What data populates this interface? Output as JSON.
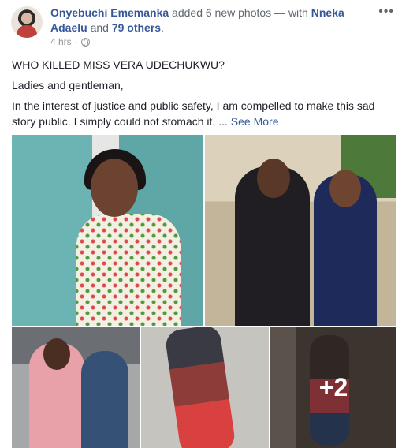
{
  "post": {
    "author": "Onyebuchi Ememanka",
    "action": " added 6 new photos",
    "with_prefix": " — with ",
    "tagged_name": "Nneka Adaelu",
    "and_text": " and ",
    "others": "79 others",
    "end": ".",
    "time": "4 hrs",
    "separator": "·",
    "more_icon": "•••",
    "title": "WHO KILLED MISS VERA UDECHUKWU?",
    "greeting": "Ladies and gentleman,",
    "body": "In the interest of justice and public safety, I am compelled to make this sad story public. I simply could not stomach it. ... ",
    "see_more": "See More"
  },
  "photos": {
    "more_count": "+2"
  }
}
